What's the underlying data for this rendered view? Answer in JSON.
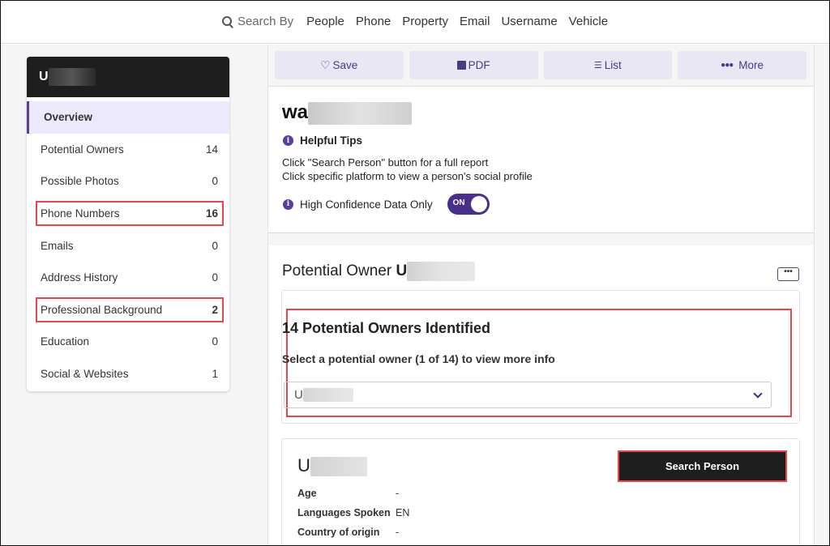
{
  "topnav": {
    "search_label": "Search By",
    "links": [
      "People",
      "Phone",
      "Property",
      "Email",
      "Username",
      "Vehicle"
    ]
  },
  "sidebar": {
    "title_visible": "U",
    "items": [
      {
        "label": "Overview",
        "count": null,
        "active": true
      },
      {
        "label": "Potential Owners",
        "count": "14"
      },
      {
        "label": "Possible Photos",
        "count": "0"
      },
      {
        "label": "Phone Numbers",
        "count": "16",
        "highlighted": true
      },
      {
        "label": "Emails",
        "count": "0"
      },
      {
        "label": "Address History",
        "count": "0"
      },
      {
        "label": "Professional Background",
        "count": "2",
        "highlighted": true
      },
      {
        "label": "Education",
        "count": "0"
      },
      {
        "label": "Social & Websites",
        "count": "1"
      }
    ]
  },
  "actions": {
    "save": "Save",
    "pdf": "PDF",
    "list": "List",
    "more": "More"
  },
  "summary": {
    "name_visible": "wa",
    "tips_title": "Helpful Tips",
    "tip1": "Click \"Search Person\" button for a full report",
    "tip2": "Click specific platform to view a person's social profile",
    "confidence_label": "High Confidence Data Only",
    "toggle_label": "ON",
    "toggle_on": true
  },
  "owner": {
    "title_prefix": "Potential Owner",
    "title_name_visible": "U",
    "more_button": "•••",
    "identified": "14 Potential Owners Identified",
    "select_prompt": "Select a potential owner (1 of 14) to view more info",
    "selected_visible": "U",
    "person_name_visible": "U",
    "search_button": "Search Person",
    "details": [
      {
        "key": "Age",
        "value": "-"
      },
      {
        "key": "Languages Spoken",
        "value": "EN"
      },
      {
        "key": "Country of origin",
        "value": "-"
      }
    ]
  },
  "colors": {
    "accent": "#5a3e9c",
    "highlight_box": "#e8454f",
    "dark": "#1e1e1e",
    "action_bg": "#e9e7f4"
  }
}
